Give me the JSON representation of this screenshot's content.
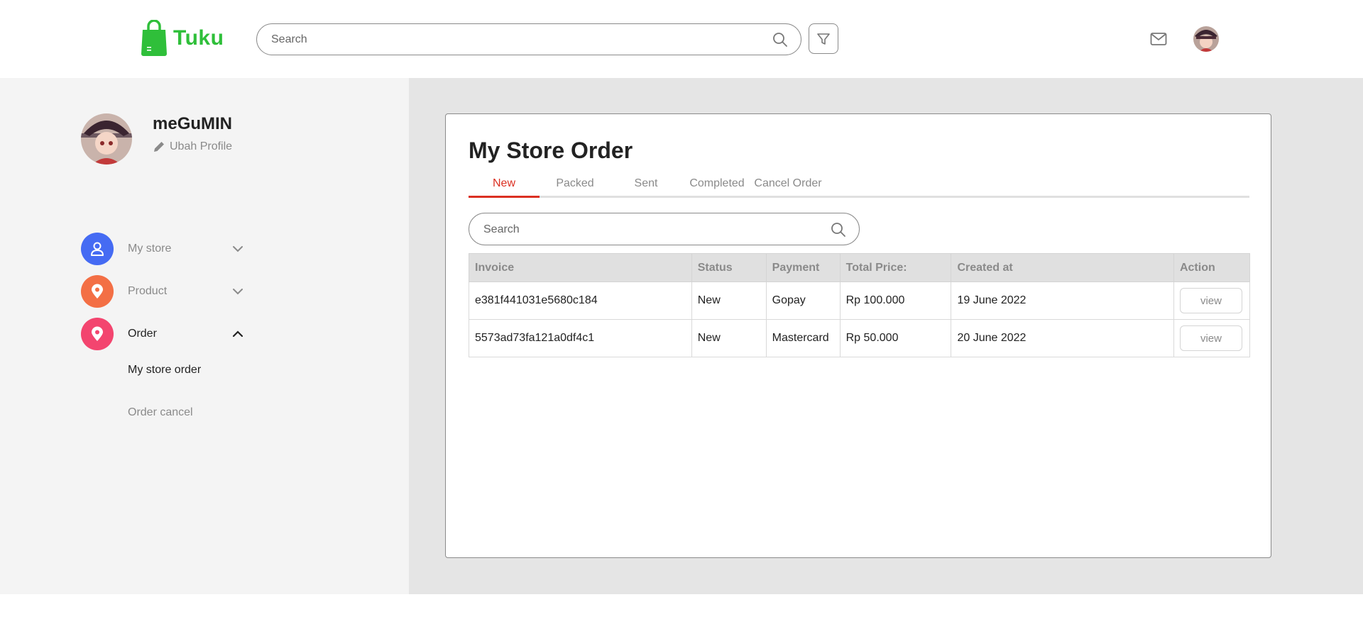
{
  "app": {
    "name": "Tuku",
    "brand_color": "#2fbf3a",
    "accent_color": "#db3022"
  },
  "header": {
    "search_placeholder": "Search",
    "icons": [
      "search-icon",
      "filter-icon",
      "mail-icon",
      "avatar"
    ]
  },
  "sidebar": {
    "profile": {
      "name": "meGuMIN",
      "edit_label": "Ubah Profile"
    },
    "items": [
      {
        "label": "My store",
        "icon": "user-icon",
        "color": "#456bf3",
        "expanded": false
      },
      {
        "label": "Product",
        "icon": "location-pin-icon",
        "color": "#f36f45",
        "expanded": false
      },
      {
        "label": "Order",
        "icon": "location-pin-icon",
        "color": "#f3456f",
        "expanded": true
      }
    ],
    "sub_items": [
      {
        "label": "My store order",
        "active": true
      },
      {
        "label": "Order cancel",
        "active": false
      }
    ]
  },
  "main": {
    "title": "My Store Order",
    "tabs": [
      "New",
      "Packed",
      "Sent",
      "Completed",
      "Cancel Order"
    ],
    "active_tab": "New",
    "search_placeholder": "Search",
    "table": {
      "columns": [
        "Invoice",
        "Status",
        "Payment",
        "Total Price:",
        "Created at",
        "Action"
      ],
      "rows": [
        {
          "invoice": "e381f441031e5680c184",
          "status": "New",
          "payment": "Gopay",
          "total": "Rp 100.000",
          "created": "19 June 2022",
          "action": "view"
        },
        {
          "invoice": "5573ad73fa121a0df4c1",
          "status": "New",
          "payment": "Mastercard",
          "total": "Rp 50.000",
          "created": "20 June 2022",
          "action": "view"
        }
      ]
    }
  }
}
